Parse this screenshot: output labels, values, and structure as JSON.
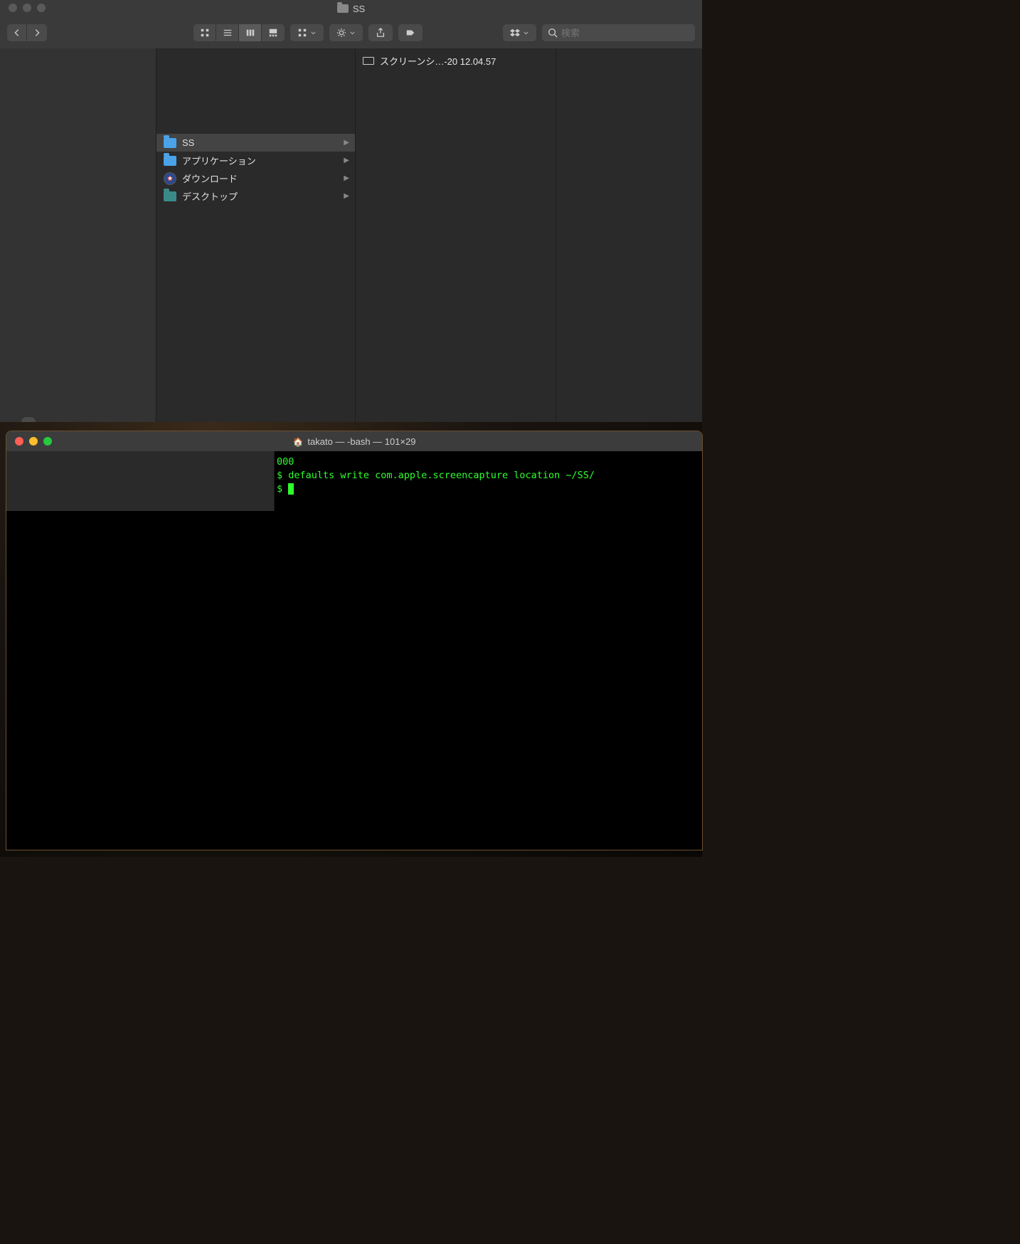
{
  "finder": {
    "title": "SS",
    "search_placeholder": "検索",
    "column1": [
      {
        "label": "SS",
        "icon": "folder-blue",
        "selected": true
      },
      {
        "label": "アプリケーション",
        "icon": "folder-blue-apps"
      },
      {
        "label": "ダウンロード",
        "icon": "shield"
      },
      {
        "label": "デスクトップ",
        "icon": "folder-teal"
      }
    ],
    "column2": [
      {
        "label": "スクリーンシ…-20 12.04.57",
        "icon": "image-file"
      }
    ]
  },
  "terminal": {
    "title": "takato — -bash — 101×29",
    "lines": [
      "000",
      "",
      "$ defaults write com.apple.screencapture location ~/SS/",
      "$ "
    ]
  }
}
